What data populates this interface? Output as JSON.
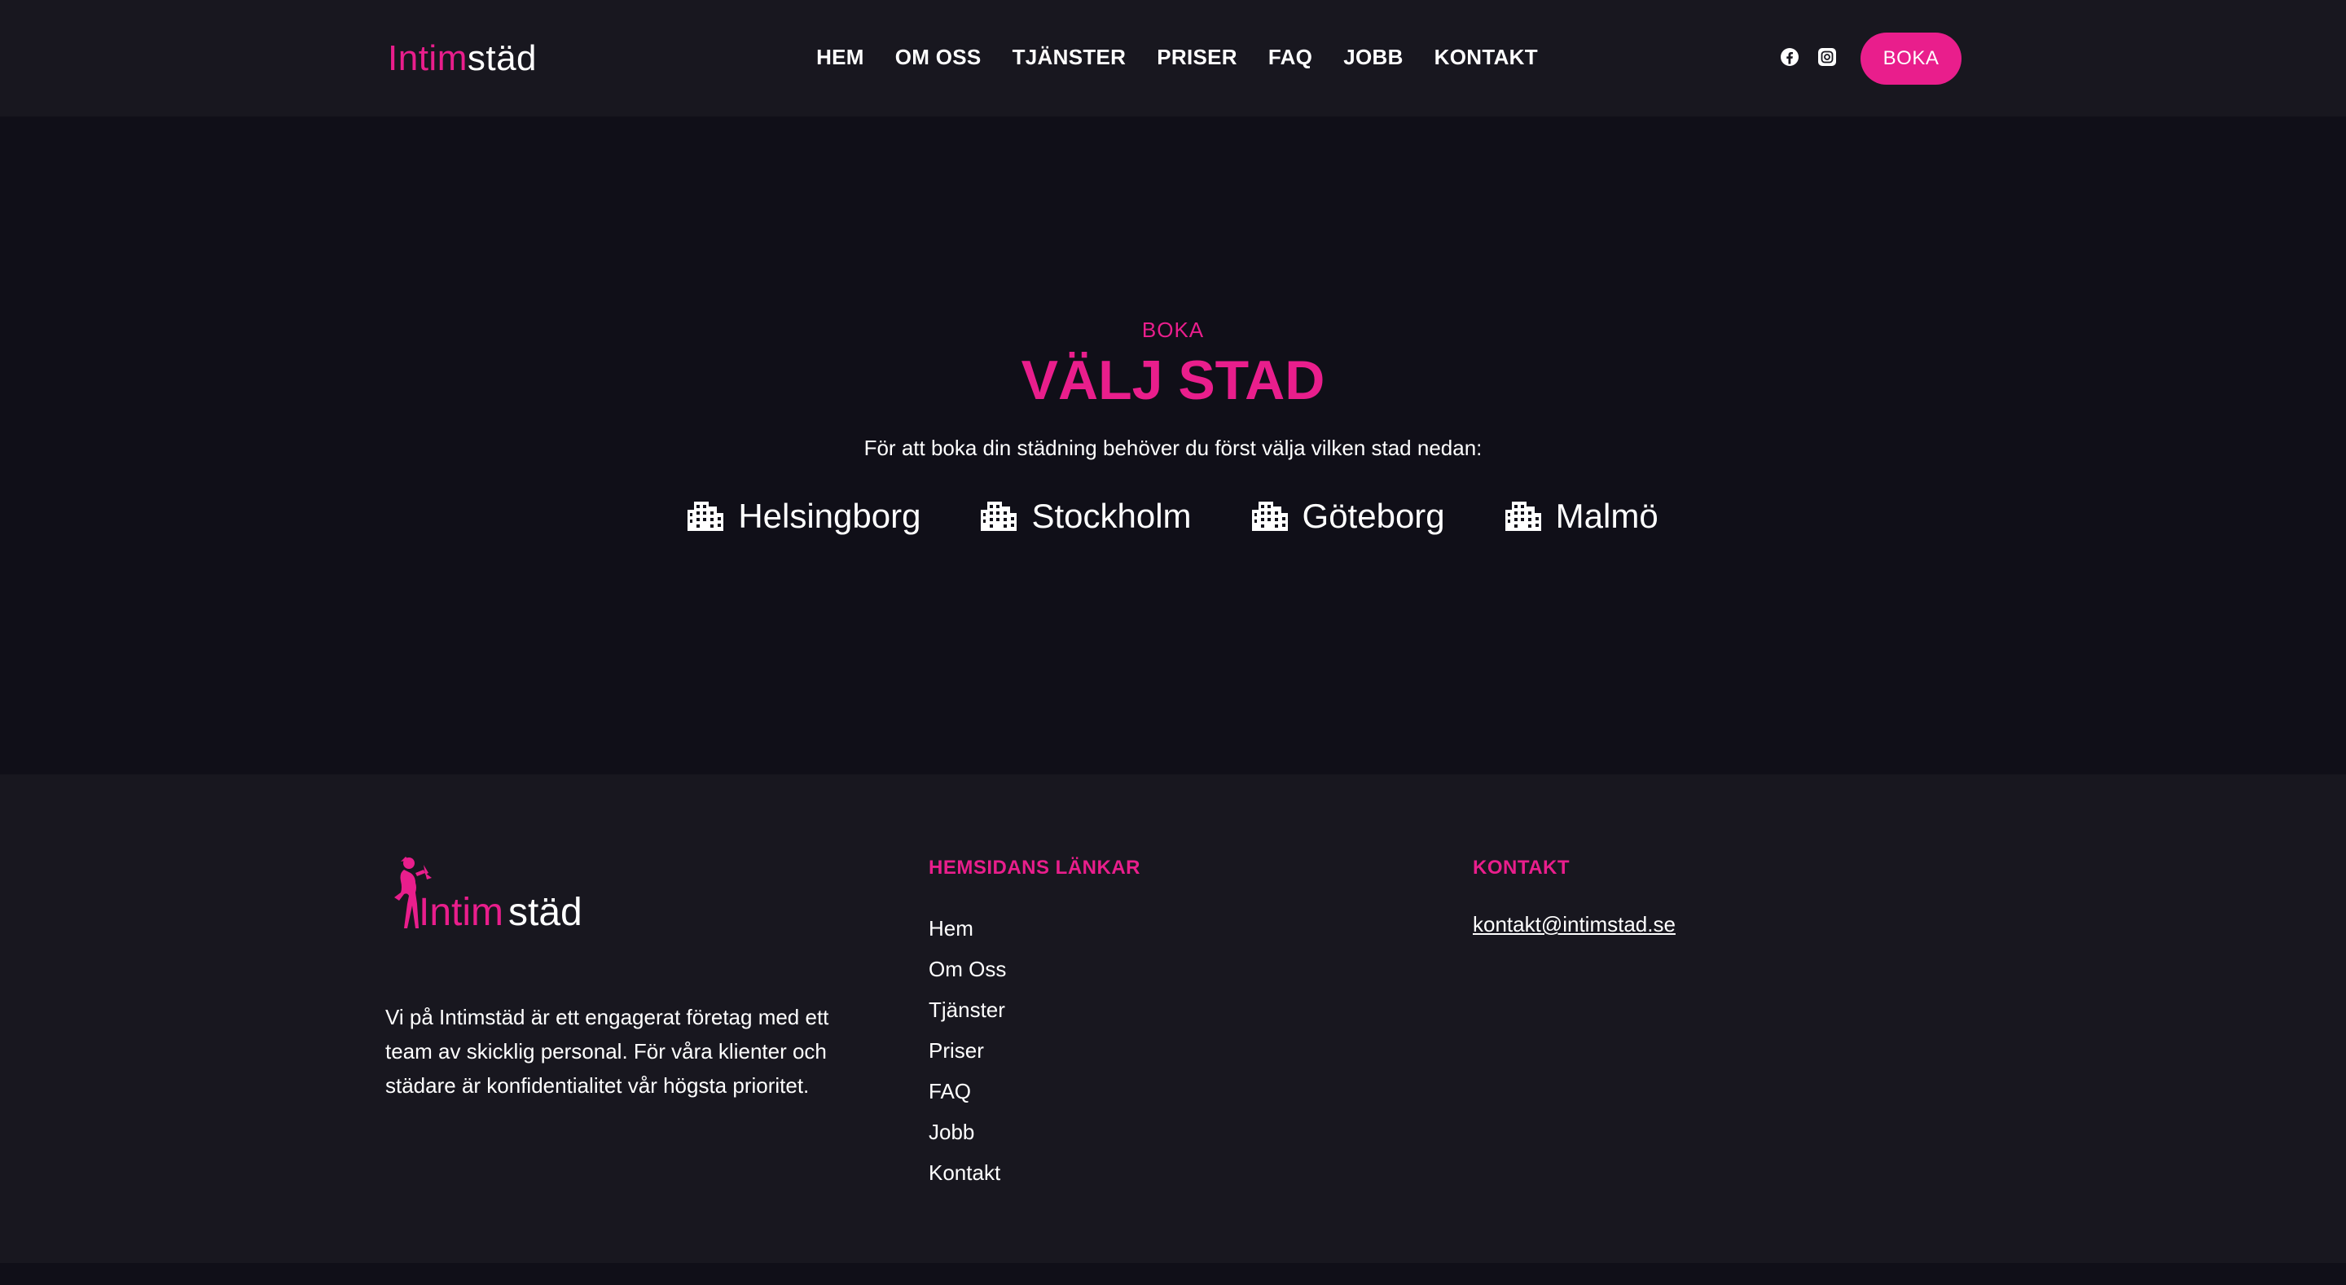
{
  "header": {
    "logo_part1": "Intim",
    "logo_part2": "städ",
    "nav": [
      "HEM",
      "OM OSS",
      "TJÄNSTER",
      "PRISER",
      "FAQ",
      "JOBB",
      "KONTAKT"
    ],
    "social": [
      "facebook-icon",
      "instagram-icon"
    ],
    "book_label": "BOKA"
  },
  "hero": {
    "eyebrow": "BOKA",
    "title": "VÄLJ STAD",
    "text": "För att boka din städning behöver du först välja vilken stad nedan:",
    "cities": [
      "Helsingborg",
      "Stockholm",
      "Göteborg",
      "Malmö"
    ],
    "city_icon": "building-icon"
  },
  "footer": {
    "logo_part1": "Intim",
    "logo_part2": "städ",
    "about": "Vi på Intimstäd är ett engagerat företag med ett team av skicklig personal. För våra klienter och städare är konfidentialitet vår högsta prioritet.",
    "links_heading": "HEMSIDANS LÄNKAR",
    "links": [
      "Hem",
      "Om Oss",
      "Tjänster",
      "Priser",
      "FAQ",
      "Jobb",
      "Kontakt"
    ],
    "contact_heading": "KONTAKT",
    "email": "kontakt@intimstad.se"
  },
  "colors": {
    "accent": "#e91e8c",
    "header_bg": "#18171f",
    "page_bg": "#100f18"
  }
}
